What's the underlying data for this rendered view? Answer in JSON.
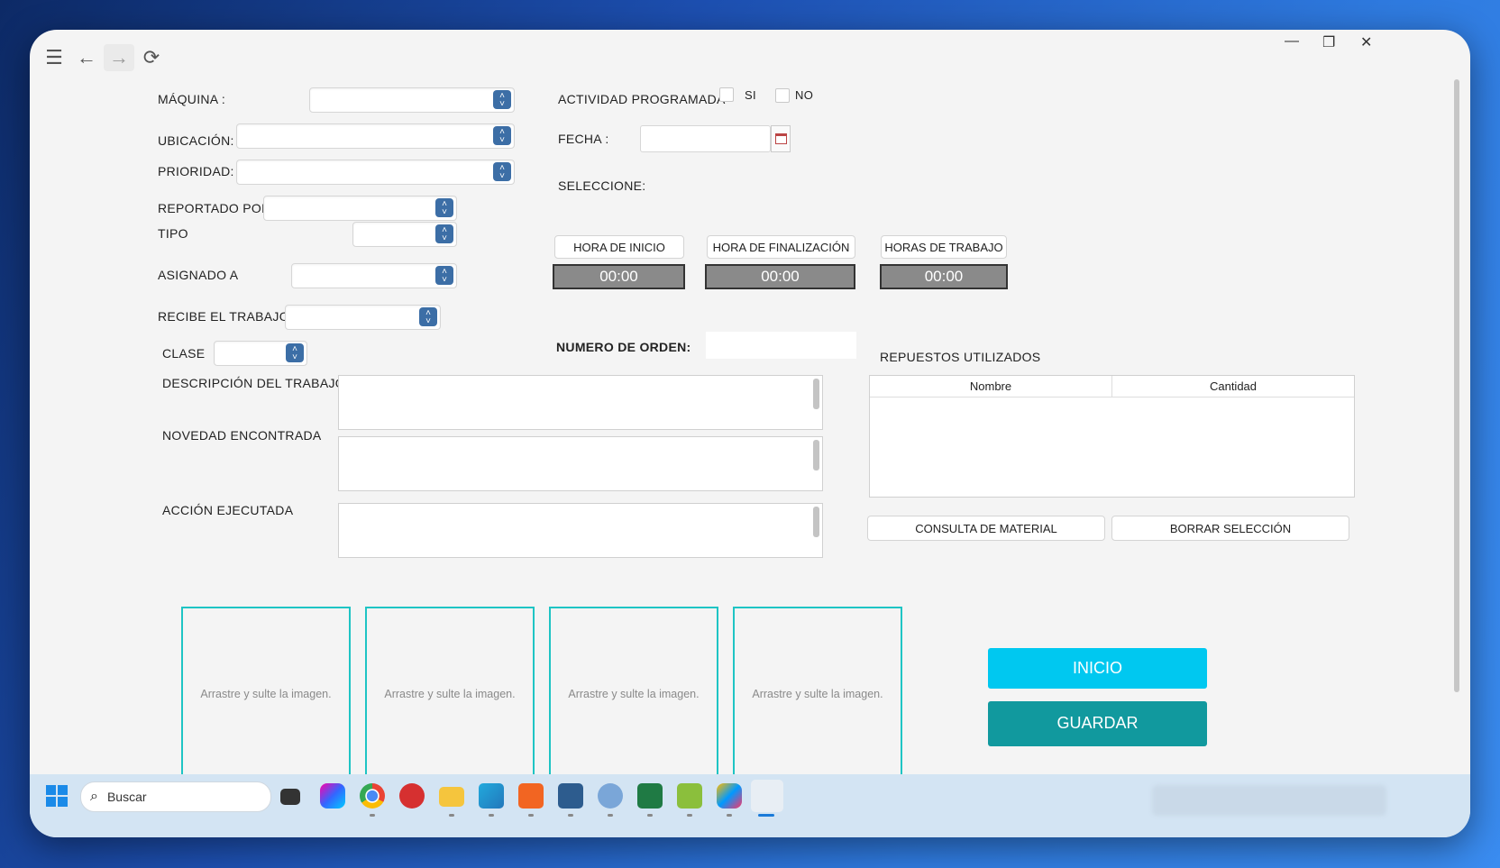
{
  "form": {
    "maquina_label": "MÁQUINA :",
    "ubicacion_label": "UBICACIÓN:",
    "prioridad_label": "PRIORIDAD:",
    "reportado_label": "REPORTADO POR",
    "tipo_label": "TIPO",
    "asignado_label": "ASIGNADO A",
    "recibe_label": "RECIBE EL TRABAJO",
    "clase_label": "CLASE",
    "descripcion_label": "DESCRIPCIÓN DEL TRABAJO",
    "novedad_label": "NOVEDAD ENCONTRADA",
    "accion_label": "ACCIÓN EJECUTADA"
  },
  "schedule": {
    "actividad_label": "ACTIVIDAD PROGRAMADA",
    "si_label": "SI",
    "no_label": "NO",
    "fecha_label": "FECHA :",
    "seleccione_label": "SELECCIONE:",
    "hora_inicio_label": "HORA DE INICIO",
    "hora_fin_label": "HORA DE FINALIZACIÓN",
    "horas_trabajo_label": "HORAS DE TRABAJO",
    "hora_inicio_value": "00:00",
    "hora_fin_value": "00:00",
    "horas_trabajo_value": "00:00",
    "numero_orden_label": "NUMERO DE ORDEN:"
  },
  "repuestos": {
    "title": "REPUESTOS UTILIZADOS",
    "columns": [
      "Nombre",
      "Cantidad"
    ],
    "consulta_label": "CONSULTA DE MATERIAL",
    "borrar_label": "BORRAR SELECCIÓN"
  },
  "images": {
    "drop_text": "Arrastre y sulte la imagen."
  },
  "actions": {
    "inicio_label": "INICIO",
    "guardar_label": "GUARDAR"
  },
  "taskbar": {
    "search_placeholder": "Buscar"
  },
  "colors": {
    "accent_cyan": "#00c8f0",
    "accent_teal": "#11999e",
    "drop_border": "#1ec4c4",
    "combo_arrow": "#3c6ea6"
  }
}
